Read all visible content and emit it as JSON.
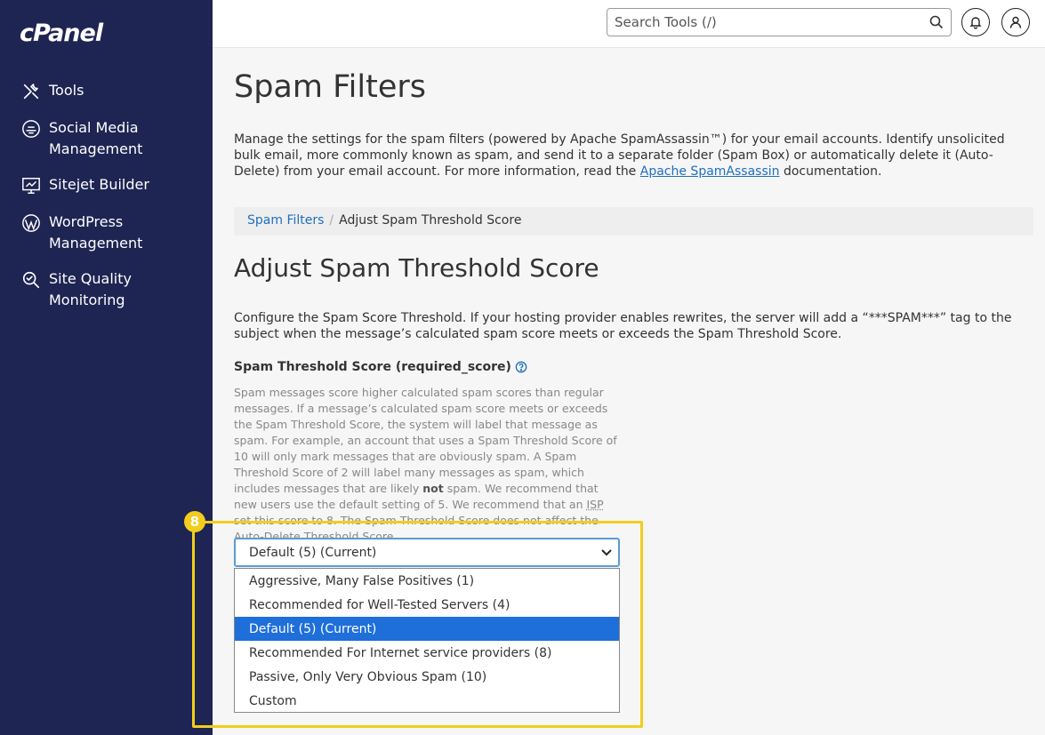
{
  "sidebar": {
    "logo": "cPanel",
    "items": [
      {
        "label": "Tools",
        "icon": "tools-icon"
      },
      {
        "label": "Social Media Management",
        "icon": "social-media-icon"
      },
      {
        "label": "Sitejet Builder",
        "icon": "sitejet-icon"
      },
      {
        "label": "WordPress Management",
        "icon": "wordpress-icon"
      },
      {
        "label": "Site Quality Monitoring",
        "icon": "site-quality-icon"
      }
    ]
  },
  "header": {
    "search_placeholder": "Search Tools (/)"
  },
  "main": {
    "page_title": "Spam Filters",
    "intro_text": "Manage the settings for the spam filters (powered by Apache SpamAssassin™) for your email accounts. Identify unsolicited bulk email, more commonly known as spam, and send it to a separate folder (Spam Box) or automatically delete it (Auto-Delete) from your email account. For more information, read the ",
    "intro_link": "Apache SpamAssassin",
    "intro_suffix": " documentation.",
    "breadcrumb": {
      "link": "Spam Filters",
      "separator": "/",
      "current": "Adjust Spam Threshold Score"
    },
    "section_title": "Adjust Spam Threshold Score",
    "section_desc": "Configure the Spam Score Threshold. If your hosting provider enables rewrites, the server will add a “***SPAM***” tag to the subject when the message’s calculated spam score meets or exceeds the Spam Threshold Score.",
    "field_label": "Spam Threshold Score (required_score)",
    "help_text_1": "Spam messages score higher calculated spam scores than regular messages. If a message’s calculated spam score meets or exceeds the Spam Threshold Score, the system will label that message as spam. For example, an account that uses a Spam Threshold Score of 10 will only mark messages that are obviously spam. A Spam Threshold Score of 2 will label many messages as spam, which includes messages that are likely ",
    "help_text_bold": "not",
    "help_text_2": " spam. We recommend that new users use the default setting of 5. We recommend that an ",
    "help_text_abbr": "ISP",
    "help_text_3": " set this score to 8. The Spam Threshold Score does not affect the Auto-Delete Threshold Score.",
    "step_number": "8",
    "select_value": "Default (5) (Current)",
    "options": [
      "Aggressive, Many False Positives (1)",
      "Recommended for Well-Tested Servers (4)",
      "Default (5) (Current)",
      "Recommended For Internet service providers (8)",
      "Passive, Only Very Obvious Spam (10)",
      "Custom"
    ],
    "selected_index": 2
  },
  "colors": {
    "sidebar_bg": "#1e2553",
    "highlight": "#f2cd1c",
    "selected_option": "#1e6fd9",
    "link": "#1e6fbf"
  }
}
